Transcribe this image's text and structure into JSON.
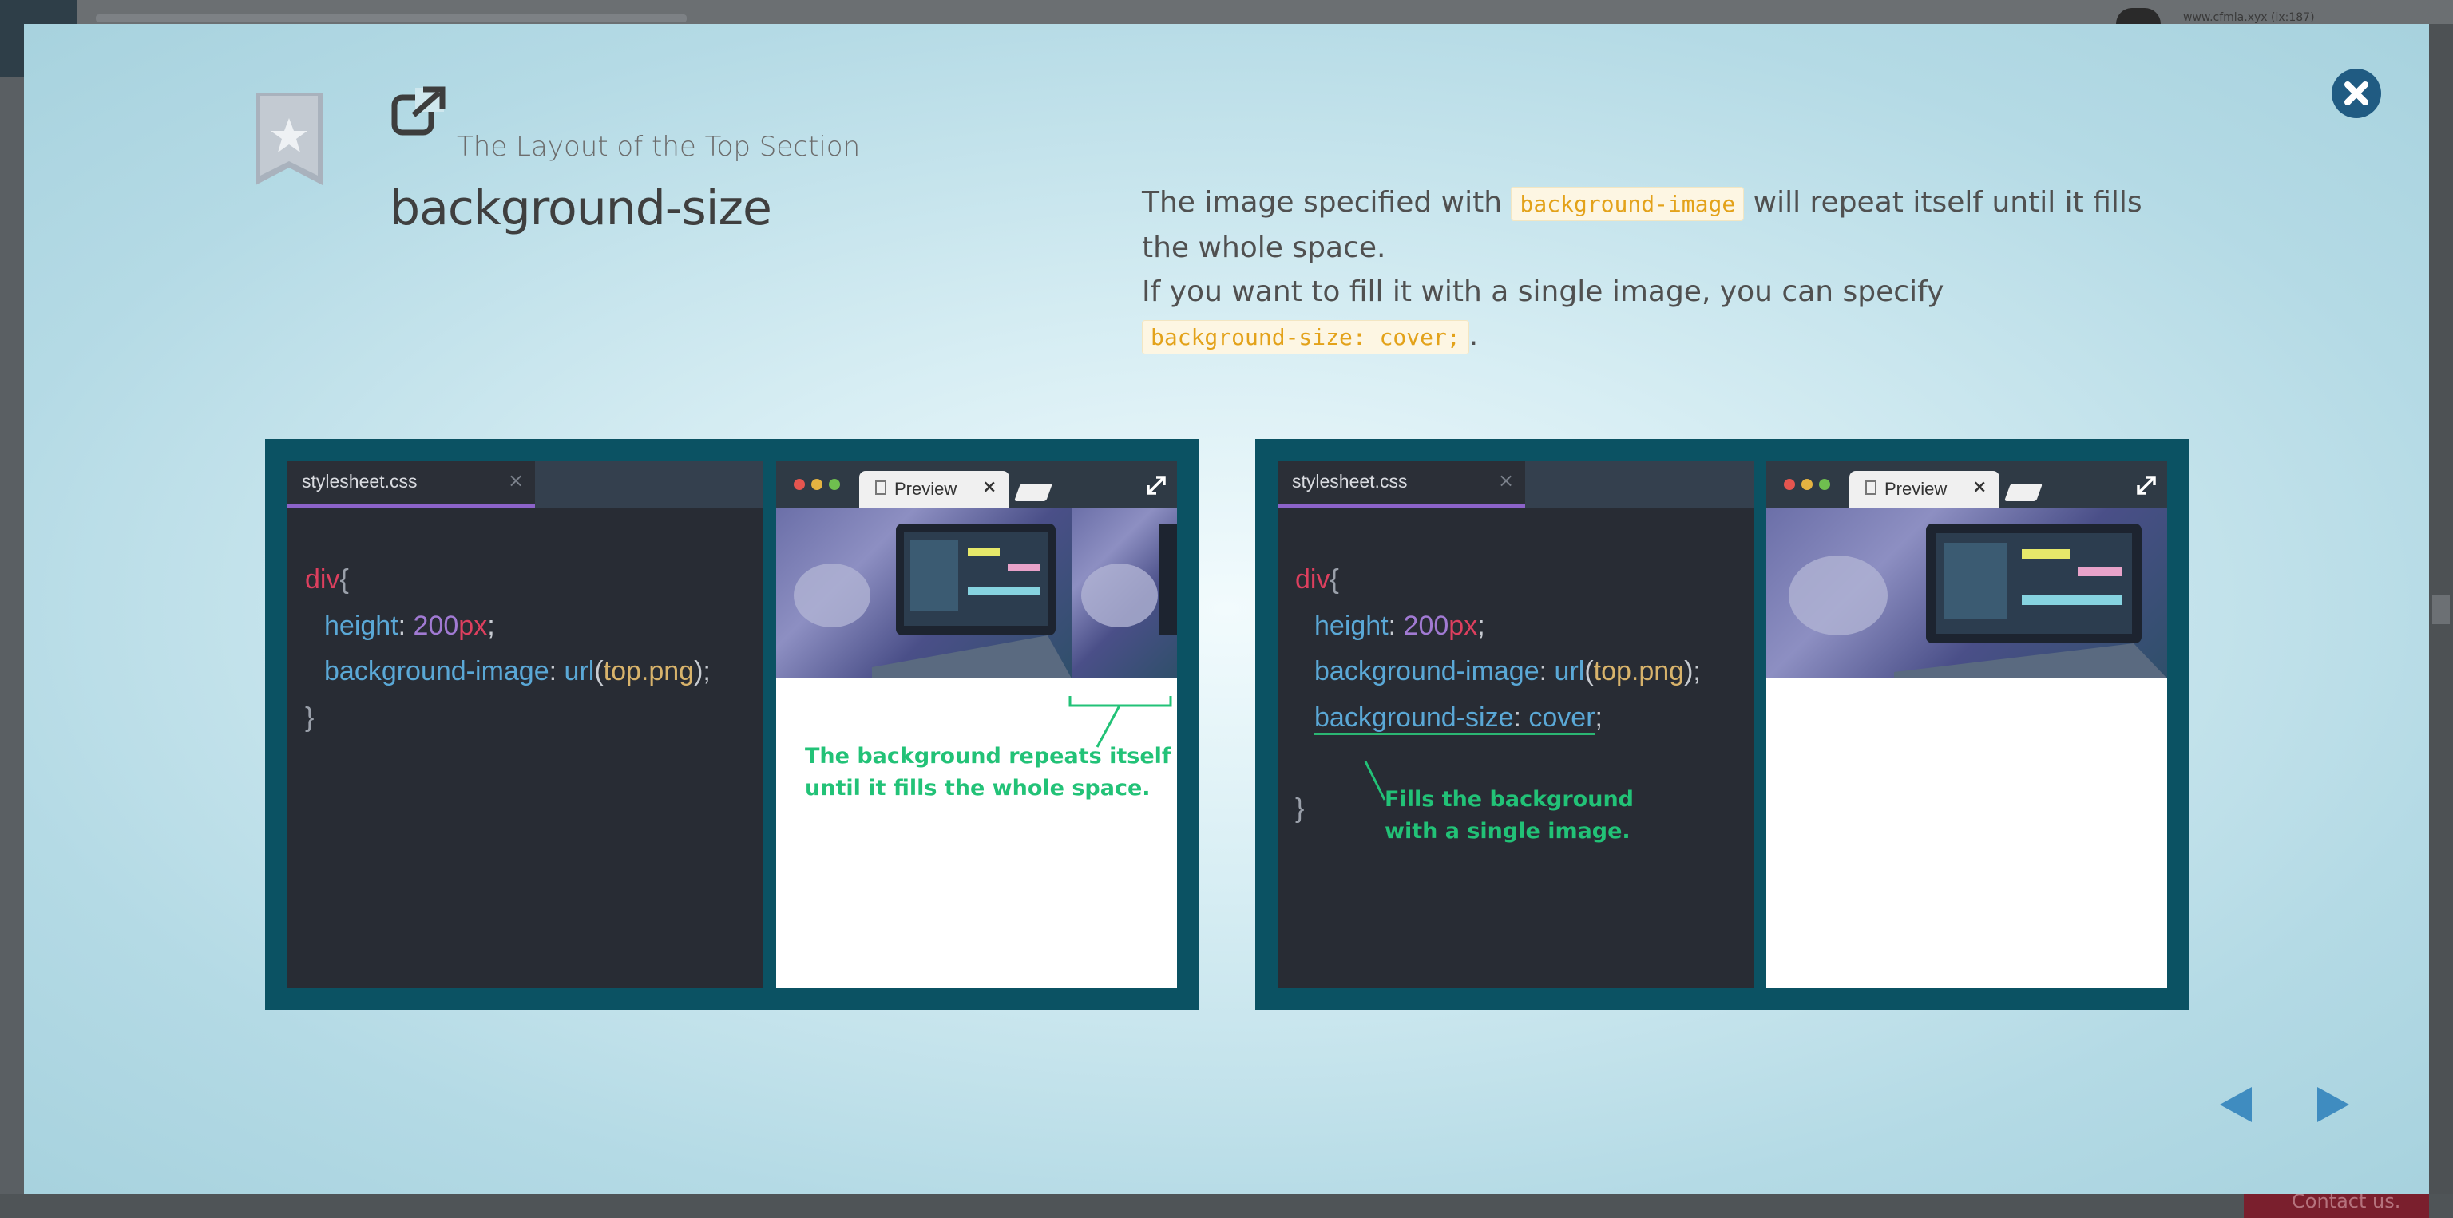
{
  "background": {
    "tiny_text": "www.cfmla.xyx (ix:187)",
    "contact_label": "Contact us."
  },
  "modal": {
    "subtitle": "The Layout of the Top Section",
    "title": "background-size",
    "description": {
      "part1": "The image specified with",
      "code1": "background-image",
      "part2": "will repeat itself until it fills the whole space.",
      "part3": "If you want to fill it with a single image, you can specify",
      "code2": "background-size: cover;",
      "part4": "."
    },
    "close_icon": "close-icon",
    "nav": {
      "prev_icon": "triangle-left-icon",
      "next_icon": "triangle-right-icon"
    },
    "colors": {
      "panel": "#0b5263",
      "accent": "#205b82",
      "annotation": "#22c277",
      "code_highlight": "#e3a21a"
    }
  },
  "panels": [
    {
      "editor_tab": "stylesheet.css",
      "editor_tab_close": "×",
      "code": {
        "selector": "div",
        "open_brace": "{",
        "line1_prop": "height",
        "line1_num": "200",
        "line1_unit": "px",
        "line2_prop": "background-image",
        "line2_func": "url",
        "line2_arg": "top.png",
        "close_brace": "}"
      },
      "preview_tab": "Preview",
      "preview_tab_close": "×",
      "annotation_line1": "The background repeats itself",
      "annotation_line2": "until it fills the whole space."
    },
    {
      "editor_tab": "stylesheet.css",
      "editor_tab_close": "×",
      "code": {
        "selector": "div",
        "open_brace": "{",
        "line1_prop": "height",
        "line1_num": "200",
        "line1_unit": "px",
        "line2_prop": "background-image",
        "line2_func": "url",
        "line2_arg": "top.png",
        "line3_prop": "background-size",
        "line3_value": "cover",
        "close_brace": "}"
      },
      "preview_tab": "Preview",
      "preview_tab_close": "×",
      "annotation_line1": "Fills the background",
      "annotation_line2": "with a single image."
    }
  ]
}
